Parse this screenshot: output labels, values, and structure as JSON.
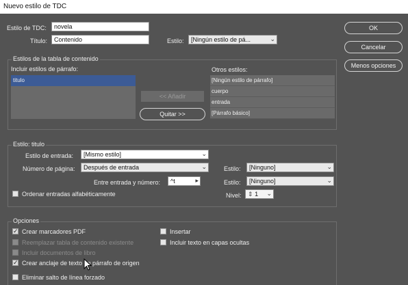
{
  "window": {
    "title": "Nuevo estilo de TDC"
  },
  "top": {
    "estilo_tdc_label": "Estilo de TDC:",
    "estilo_tdc_value": "novela",
    "titulo_label": "Título:",
    "titulo_value": "Contenido",
    "estilo_label": "Estilo:",
    "estilo_value": "[Ningún estilo de pá..."
  },
  "buttons": {
    "ok": "OK",
    "cancel": "Cancelar",
    "fewer": "Menos opciones"
  },
  "estilos_tabla": {
    "group_label": "Estilos de la tabla de contenido",
    "incluir_label": "Incluir estilos de párrafo:",
    "incluir_items": [
      "titulo"
    ],
    "add_label": "<< Añadir",
    "remove_label": "Quitar >>",
    "otros_label": "Otros estilos:",
    "otros_items": [
      "[Ningún estilo de párrafo]",
      "cuerpo",
      "entrada",
      "[Párrafo básico]"
    ]
  },
  "estilo_titulo": {
    "group_label": "Estilo: titulo",
    "entrada_label": "Estilo de entrada:",
    "entrada_value": "[Mismo estilo]",
    "numero_label": "Número de página:",
    "numero_value": "Después de entrada",
    "estilo1_label": "Estilo:",
    "estilo1_value": "[Ninguno]",
    "entre_label": "Entre entrada y número:",
    "entre_value": "^t",
    "estilo2_label": "Estilo:",
    "estilo2_value": "[Ninguno]",
    "ordenar_label": "Ordenar entradas alfabéticamente",
    "nivel_label": "Nivel:",
    "nivel_value": "1"
  },
  "opciones": {
    "group_label": "Opciones",
    "crear_marcadores": "Crear marcadores PDF",
    "reemplazar": "Reemplazar tabla de contenido existente",
    "incluir_documentos": "Incluir documentos de libro",
    "crear_anclaje": "Crear anclaje de texto en párrafo de origen",
    "eliminar_salto": "Eliminar salto de línea forzado",
    "insertar": "Insertar",
    "incluir_texto": "Incluir texto en capas ocultas"
  }
}
